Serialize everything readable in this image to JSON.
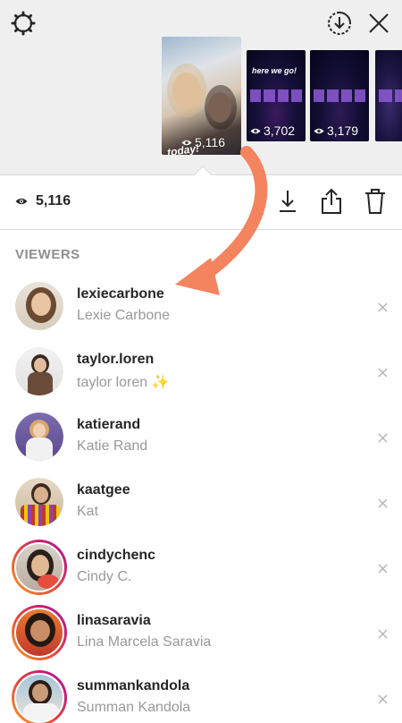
{
  "story_strip": {
    "thumbnails": [
      {
        "caption": "",
        "views": "5,116",
        "selected": true
      },
      {
        "caption": "here we go!",
        "views": "3,702",
        "selected": false
      },
      {
        "caption": "",
        "views": "3,179",
        "selected": false
      },
      {
        "caption": "",
        "views": "",
        "selected": false
      }
    ],
    "selected_overlay_text": "today!"
  },
  "stats": {
    "view_count": "5,116"
  },
  "viewers": {
    "heading": "VIEWERS",
    "list": [
      {
        "username": "lexiecarbone",
        "full_name": "Lexie Carbone",
        "ring": false
      },
      {
        "username": "taylor.loren",
        "full_name": "taylor loren ✨",
        "ring": false
      },
      {
        "username": "katierand",
        "full_name": "Katie Rand",
        "ring": false
      },
      {
        "username": "kaatgee",
        "full_name": "Kat",
        "ring": false
      },
      {
        "username": "cindychenc",
        "full_name": "Cindy C.",
        "ring": true
      },
      {
        "username": "linasaravia",
        "full_name": "Lina Marcela Saravia",
        "ring": true
      },
      {
        "username": "summankandola",
        "full_name": "Summan Kandola",
        "ring": true
      }
    ]
  },
  "colors": {
    "annotation_arrow": "#f4845f",
    "ring_start": "#f9a124",
    "ring_end": "#8e2da8",
    "muted_text": "#999999"
  },
  "icons": {
    "settings": "gear-icon",
    "download_story": "download-circle-icon",
    "close": "close-icon",
    "eye": "eye-icon",
    "save": "download-icon",
    "share": "share-icon",
    "delete": "trash-icon",
    "remove": "remove-x-icon"
  }
}
